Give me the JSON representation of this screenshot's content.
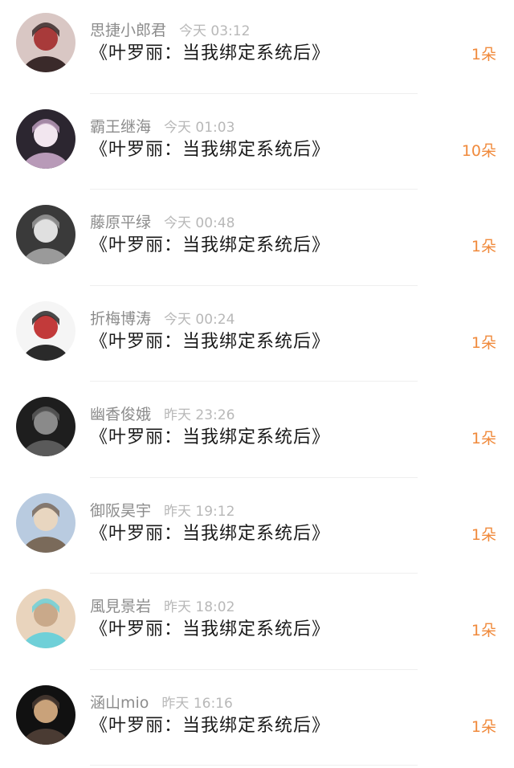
{
  "gifts": [
    {
      "username": "思捷小郎君",
      "time": "今天 03:12",
      "title": "《叶罗丽：当我绑定系统后》",
      "count": "1朵",
      "avatar_colors": [
        "#d9c7c4",
        "#3a2a2a",
        "#a83a3a"
      ]
    },
    {
      "username": "霸王继海",
      "time": "今天 01:03",
      "title": "《叶罗丽：当我绑定系统后》",
      "count": "10朵",
      "avatar_colors": [
        "#2c2630",
        "#b89ab8",
        "#f2e6ef"
      ]
    },
    {
      "username": "藤原平绿",
      "time": "今天 00:48",
      "title": "《叶罗丽：当我绑定系统后》",
      "count": "1朵",
      "avatar_colors": [
        "#3a3a3a",
        "#9a9a9a",
        "#e0e0e0"
      ]
    },
    {
      "username": "折梅博涛",
      "time": "今天 00:24",
      "title": "《叶罗丽：当我绑定系统后》",
      "count": "1朵",
      "avatar_colors": [
        "#f5f5f5",
        "#2a2a2a",
        "#c23a3a"
      ]
    },
    {
      "username": "幽香俊娥",
      "time": "昨天 23:26",
      "title": "《叶罗丽：当我绑定系统后》",
      "count": "1朵",
      "avatar_colors": [
        "#1e1e1e",
        "#5a5a5a",
        "#8a8a8a"
      ]
    },
    {
      "username": "御阪昊宇",
      "time": "昨天 19:12",
      "title": "《叶罗丽：当我绑定系统后》",
      "count": "1朵",
      "avatar_colors": [
        "#b9cbe0",
        "#7a6a5a",
        "#e8d6c0"
      ]
    },
    {
      "username": "風見景岩",
      "time": "昨天 18:02",
      "title": "《叶罗丽：当我绑定系统后》",
      "count": "1朵",
      "avatar_colors": [
        "#e9d4bd",
        "#6fd0d8",
        "#c9a98a"
      ]
    },
    {
      "username": "涵山mio",
      "time": "昨天 16:16",
      "title": "《叶罗丽：当我绑定系统后》",
      "count": "1朵",
      "avatar_colors": [
        "#111111",
        "#4a3b33",
        "#c9a27a"
      ]
    }
  ],
  "theme": {
    "count_color": "#f08a3c",
    "username_color": "#8c8c8c",
    "time_color": "#b8b8b8",
    "title_color": "#1a1a1a"
  }
}
